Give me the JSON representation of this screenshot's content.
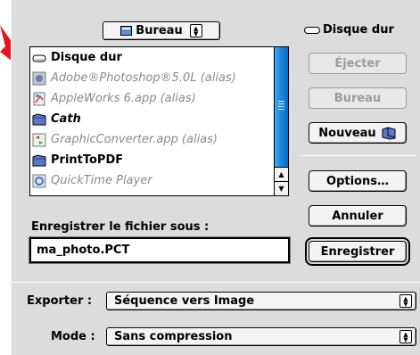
{
  "folder_popup": {
    "label": "Bureau",
    "icon": "desktop-icon"
  },
  "volume_label": "Disque dur",
  "file_list": [
    {
      "name": "Disque dur",
      "icon": "hard-disk-icon",
      "style": "bold"
    },
    {
      "name": "Adobe®Photoshop®5.0L (alias)",
      "icon": "photoshop-alias-icon",
      "style": "alias"
    },
    {
      "name": "AppleWorks 6.app (alias)",
      "icon": "appleworks-alias-icon",
      "style": "alias"
    },
    {
      "name": "Cath",
      "icon": "folder-icon",
      "style": "italic-bold"
    },
    {
      "name": "GraphicConverter.app (alias)",
      "icon": "graphicconverter-alias-icon",
      "style": "alias"
    },
    {
      "name": "PrintToPDF",
      "icon": "folder-icon",
      "style": "bold"
    },
    {
      "name": "QuickTime Player",
      "icon": "quicktime-icon",
      "style": "grey"
    }
  ],
  "buttons": {
    "eject": "Éjecter",
    "desktop": "Bureau",
    "new_folder": "Nouveau",
    "options": "Options…",
    "cancel": "Annuler",
    "save": "Enregistrer"
  },
  "save_as_label": "Enregistrer le fichier sous :",
  "save_as_value": "ma_photo.PCT",
  "export_label": "Exporter :",
  "export_value": "Séquence vers Image",
  "mode_label": "Mode :",
  "mode_value": "Sans compression",
  "accent_color": "#1388e0",
  "arrow_color": "#e8141b"
}
